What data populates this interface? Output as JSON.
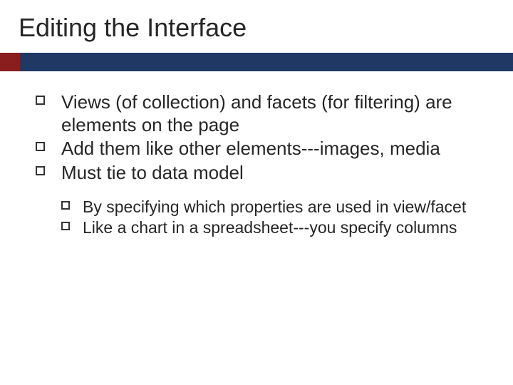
{
  "title": "Editing the Interface",
  "bullets": [
    "Views (of collection) and facets (for filtering) are elements on the page",
    "Add them like other elements---images, media",
    "Must tie to data model"
  ],
  "sub_bullets": [
    "By specifying which properties are used in view/facet",
    "Like a chart in a spreadsheet---you specify columns"
  ],
  "colors": {
    "accent": "#8a1d1d",
    "bar": "#1f3864"
  }
}
